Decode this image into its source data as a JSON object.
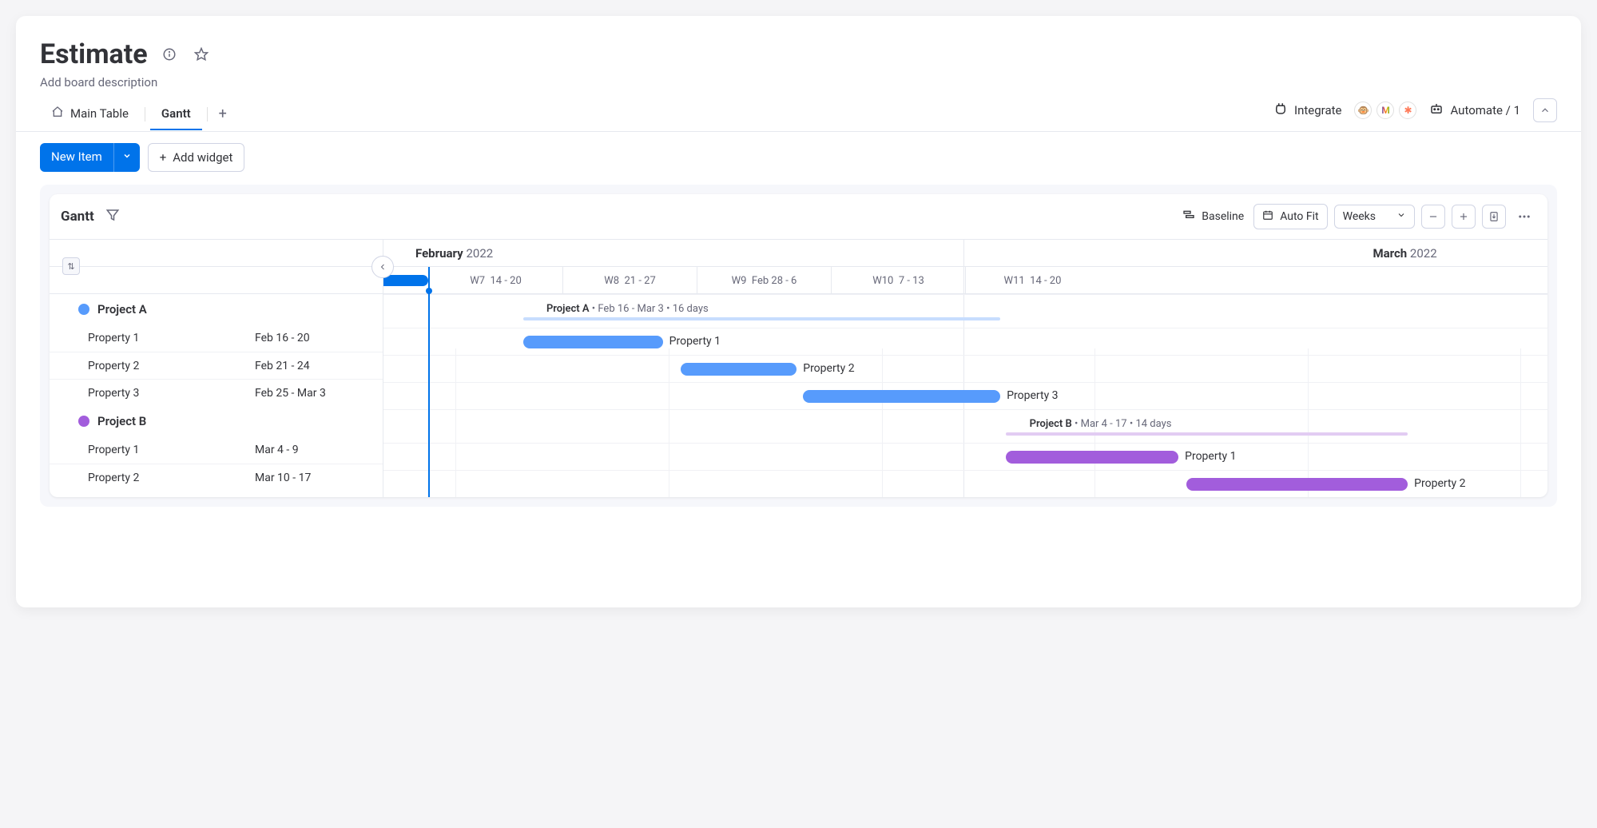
{
  "header": {
    "title": "Estimate",
    "subtitle": "Add board description"
  },
  "tabs": {
    "main_table": "Main Table",
    "gantt": "Gantt"
  },
  "top_actions": {
    "integrate": "Integrate",
    "automate": "Automate / 1"
  },
  "actions": {
    "new_item": "New Item",
    "add_widget": "Add widget"
  },
  "gantt": {
    "title": "Gantt",
    "tools": {
      "baseline": "Baseline",
      "autofit": "Auto Fit",
      "scale": "Weeks"
    },
    "months": [
      {
        "name": "February",
        "year": "2022"
      },
      {
        "name": "March",
        "year": "2022"
      }
    ],
    "weeks": [
      {
        "label": "W7",
        "dates": "14 - 20"
      },
      {
        "label": "W8",
        "dates": "21 - 27"
      },
      {
        "label": "W9",
        "dates": "Feb 28 - 6"
      },
      {
        "label": "W10",
        "dates": "7 - 13"
      },
      {
        "label": "W11",
        "dates": "14 - 20"
      }
    ],
    "groups": [
      {
        "name": "Project A",
        "color": "#579bfc",
        "summary_light": "#c7ddfe",
        "summary_text": {
          "name": "Project A",
          "range": "Feb 16 - Mar 3",
          "duration": "16 days"
        },
        "tasks": [
          {
            "name": "Property 1",
            "date_label": "Feb 16 - 20",
            "start_pct": 12,
            "width_pct": 12
          },
          {
            "name": "Property 2",
            "date_label": "Feb 21 - 24",
            "start_pct": 25.5,
            "width_pct": 10
          },
          {
            "name": "Property 3",
            "date_label": "Feb 25 - Mar 3",
            "start_pct": 36,
            "width_pct": 17
          }
        ]
      },
      {
        "name": "Project B",
        "color": "#a25ddc",
        "summary_light": "#e2ccf3",
        "summary_text": {
          "name": "Project B",
          "range": "Mar 4 - 17",
          "duration": "14 days"
        },
        "tasks": [
          {
            "name": "Property 1",
            "date_label": "Mar 4 - 9",
            "start_pct": 53.5,
            "width_pct": 14.8
          },
          {
            "name": "Property 2",
            "date_label": "Mar 10 - 17",
            "start_pct": 69,
            "width_pct": 19
          }
        ]
      }
    ]
  },
  "chart_data": {
    "type": "gantt",
    "title": "Estimate — Gantt",
    "x_axis": {
      "unit": "weeks",
      "range_start": "2022-02-14",
      "range_end": "2022-03-20",
      "ticks": [
        "W7 14-20",
        "W8 21-27",
        "W9 Feb 28-6",
        "W10 7-13",
        "W11 14-20"
      ]
    },
    "series": [
      {
        "name": "Project A",
        "color": "#579bfc",
        "summary": {
          "start": "2022-02-16",
          "end": "2022-03-03",
          "duration_days": 16
        },
        "tasks": [
          {
            "name": "Property 1",
            "start": "2022-02-16",
            "end": "2022-02-20"
          },
          {
            "name": "Property 2",
            "start": "2022-02-21",
            "end": "2022-02-24"
          },
          {
            "name": "Property 3",
            "start": "2022-02-25",
            "end": "2022-03-03"
          }
        ]
      },
      {
        "name": "Project B",
        "color": "#a25ddc",
        "summary": {
          "start": "2022-03-04",
          "end": "2022-03-17",
          "duration_days": 14
        },
        "tasks": [
          {
            "name": "Property 1",
            "start": "2022-03-04",
            "end": "2022-03-09"
          },
          {
            "name": "Property 2",
            "start": "2022-03-10",
            "end": "2022-03-17"
          }
        ]
      }
    ]
  }
}
